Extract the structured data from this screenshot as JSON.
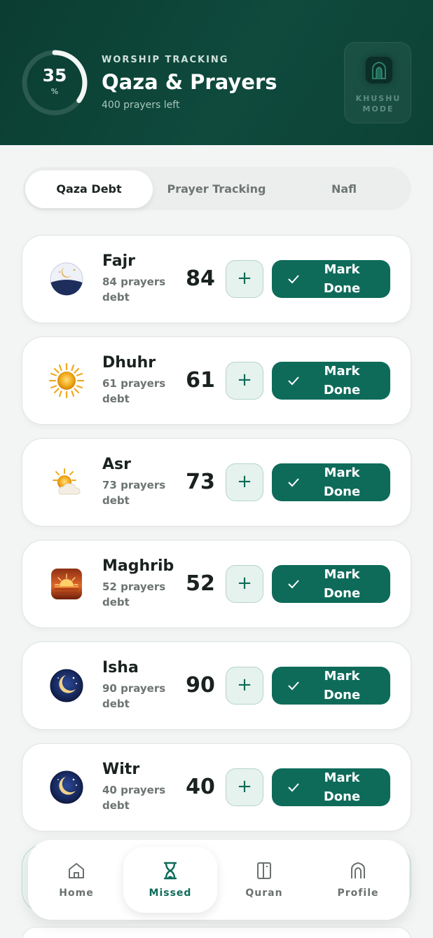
{
  "header": {
    "progress_value": "35",
    "progress_unit": "%",
    "progress_fraction": 0.35,
    "eyebrow": "WORSHIP TRACKING",
    "title": "Qaza & Prayers",
    "subtitle": "400 prayers left",
    "khushu_line1": "KHUSHU",
    "khushu_line2": "MODE"
  },
  "tabs": [
    {
      "label": "Qaza Debt",
      "active": true
    },
    {
      "label": "Prayer Tracking",
      "active": false
    },
    {
      "label": "Nafl",
      "active": false
    }
  ],
  "prayers": [
    {
      "name": "Fajr",
      "debt_line1": "84 prayers",
      "debt_line2": "debt",
      "count": "84",
      "icon": "crescent-dawn-icon"
    },
    {
      "name": "Dhuhr",
      "debt_line1": "61 prayers",
      "debt_line2": "debt",
      "count": "61",
      "icon": "sun-icon"
    },
    {
      "name": "Asr",
      "debt_line1": "73 prayers",
      "debt_line2": "debt",
      "count": "73",
      "icon": "sun-cloud-icon"
    },
    {
      "name": "Maghrib",
      "debt_line1": "52 prayers",
      "debt_line2": "debt",
      "count": "52",
      "icon": "sunset-icon"
    },
    {
      "name": "Isha",
      "debt_line1": "90 prayers",
      "debt_line2": "debt",
      "count": "90",
      "icon": "crescent-night-icon"
    },
    {
      "name": "Witr",
      "debt_line1": "40 prayers",
      "debt_line2": "debt",
      "count": "40",
      "icon": "crescent-night-icon"
    }
  ],
  "actions": {
    "plus": "+",
    "mark_line1": "Mark",
    "mark_line2": "Done"
  },
  "nav": [
    {
      "label": "Home",
      "icon": "home-icon",
      "active": false
    },
    {
      "label": "Missed",
      "icon": "hourglass-icon",
      "active": true
    },
    {
      "label": "Quran",
      "icon": "book-icon",
      "active": false
    },
    {
      "label": "Profile",
      "icon": "mihrab-icon",
      "active": false
    }
  ],
  "colors": {
    "header_bg": "#0f4a3d",
    "accent": "#0e6b5a",
    "plus_bg": "#e6f2ee"
  }
}
